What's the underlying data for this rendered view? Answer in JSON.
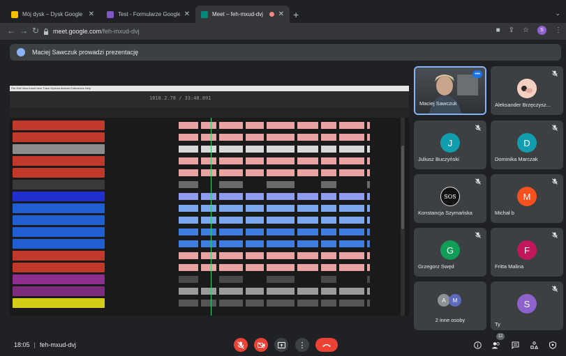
{
  "browser": {
    "tabs": [
      {
        "title": "Mój dysk – Dysk Google",
        "favicon_color": "#fbbc04"
      },
      {
        "title": "Test - Formularze Google",
        "favicon_color": "#7e57c2"
      },
      {
        "title": "Meet – feh-mxud-dvj",
        "favicon_color": "#00897b"
      }
    ],
    "url_host": "meet.google.com",
    "url_path": "/feh-mxud-dvj",
    "profile_initial": "S"
  },
  "meet": {
    "presenting_banner": "Maciej Sawczuk prowadzi prezentację",
    "presentation": {
      "time_display": "1018.2.78 / 33:48.891"
    },
    "participants": [
      {
        "name": "Maciej Sawczuk",
        "type": "video",
        "speaking": true,
        "muted": false
      },
      {
        "name": "Aleksander Brzęczysz...",
        "type": "photo",
        "muted": true,
        "photo_color": "#f1c6a8"
      },
      {
        "name": "Juliusz Buczyński",
        "initial": "J",
        "avatar_color": "#129eaf",
        "muted": true
      },
      {
        "name": "Dominika Marczak",
        "initial": "D",
        "avatar_color": "#129eaf",
        "muted": true
      },
      {
        "name": "Konstancja Szymańska",
        "type": "logo",
        "logo_text": "SOS",
        "muted": true
      },
      {
        "name": "Michał b",
        "initial": "M",
        "avatar_color": "#f4511e",
        "muted": true
      },
      {
        "name": "Grzegorz Swęd",
        "initial": "G",
        "avatar_color": "#0f9d58",
        "muted": true
      },
      {
        "name": "Fritta Malina",
        "initial": "F",
        "avatar_color": "#c2185b",
        "muted": true
      },
      {
        "name": "2 inne osoby",
        "type": "group",
        "initials": [
          "A",
          "M"
        ]
      },
      {
        "name": "Ty",
        "initial": "S",
        "avatar_color": "#8e63ce",
        "muted": true
      }
    ],
    "bottom": {
      "time": "18:05",
      "meeting_code": "feh-mxud-dvj",
      "participant_count": "12"
    }
  }
}
